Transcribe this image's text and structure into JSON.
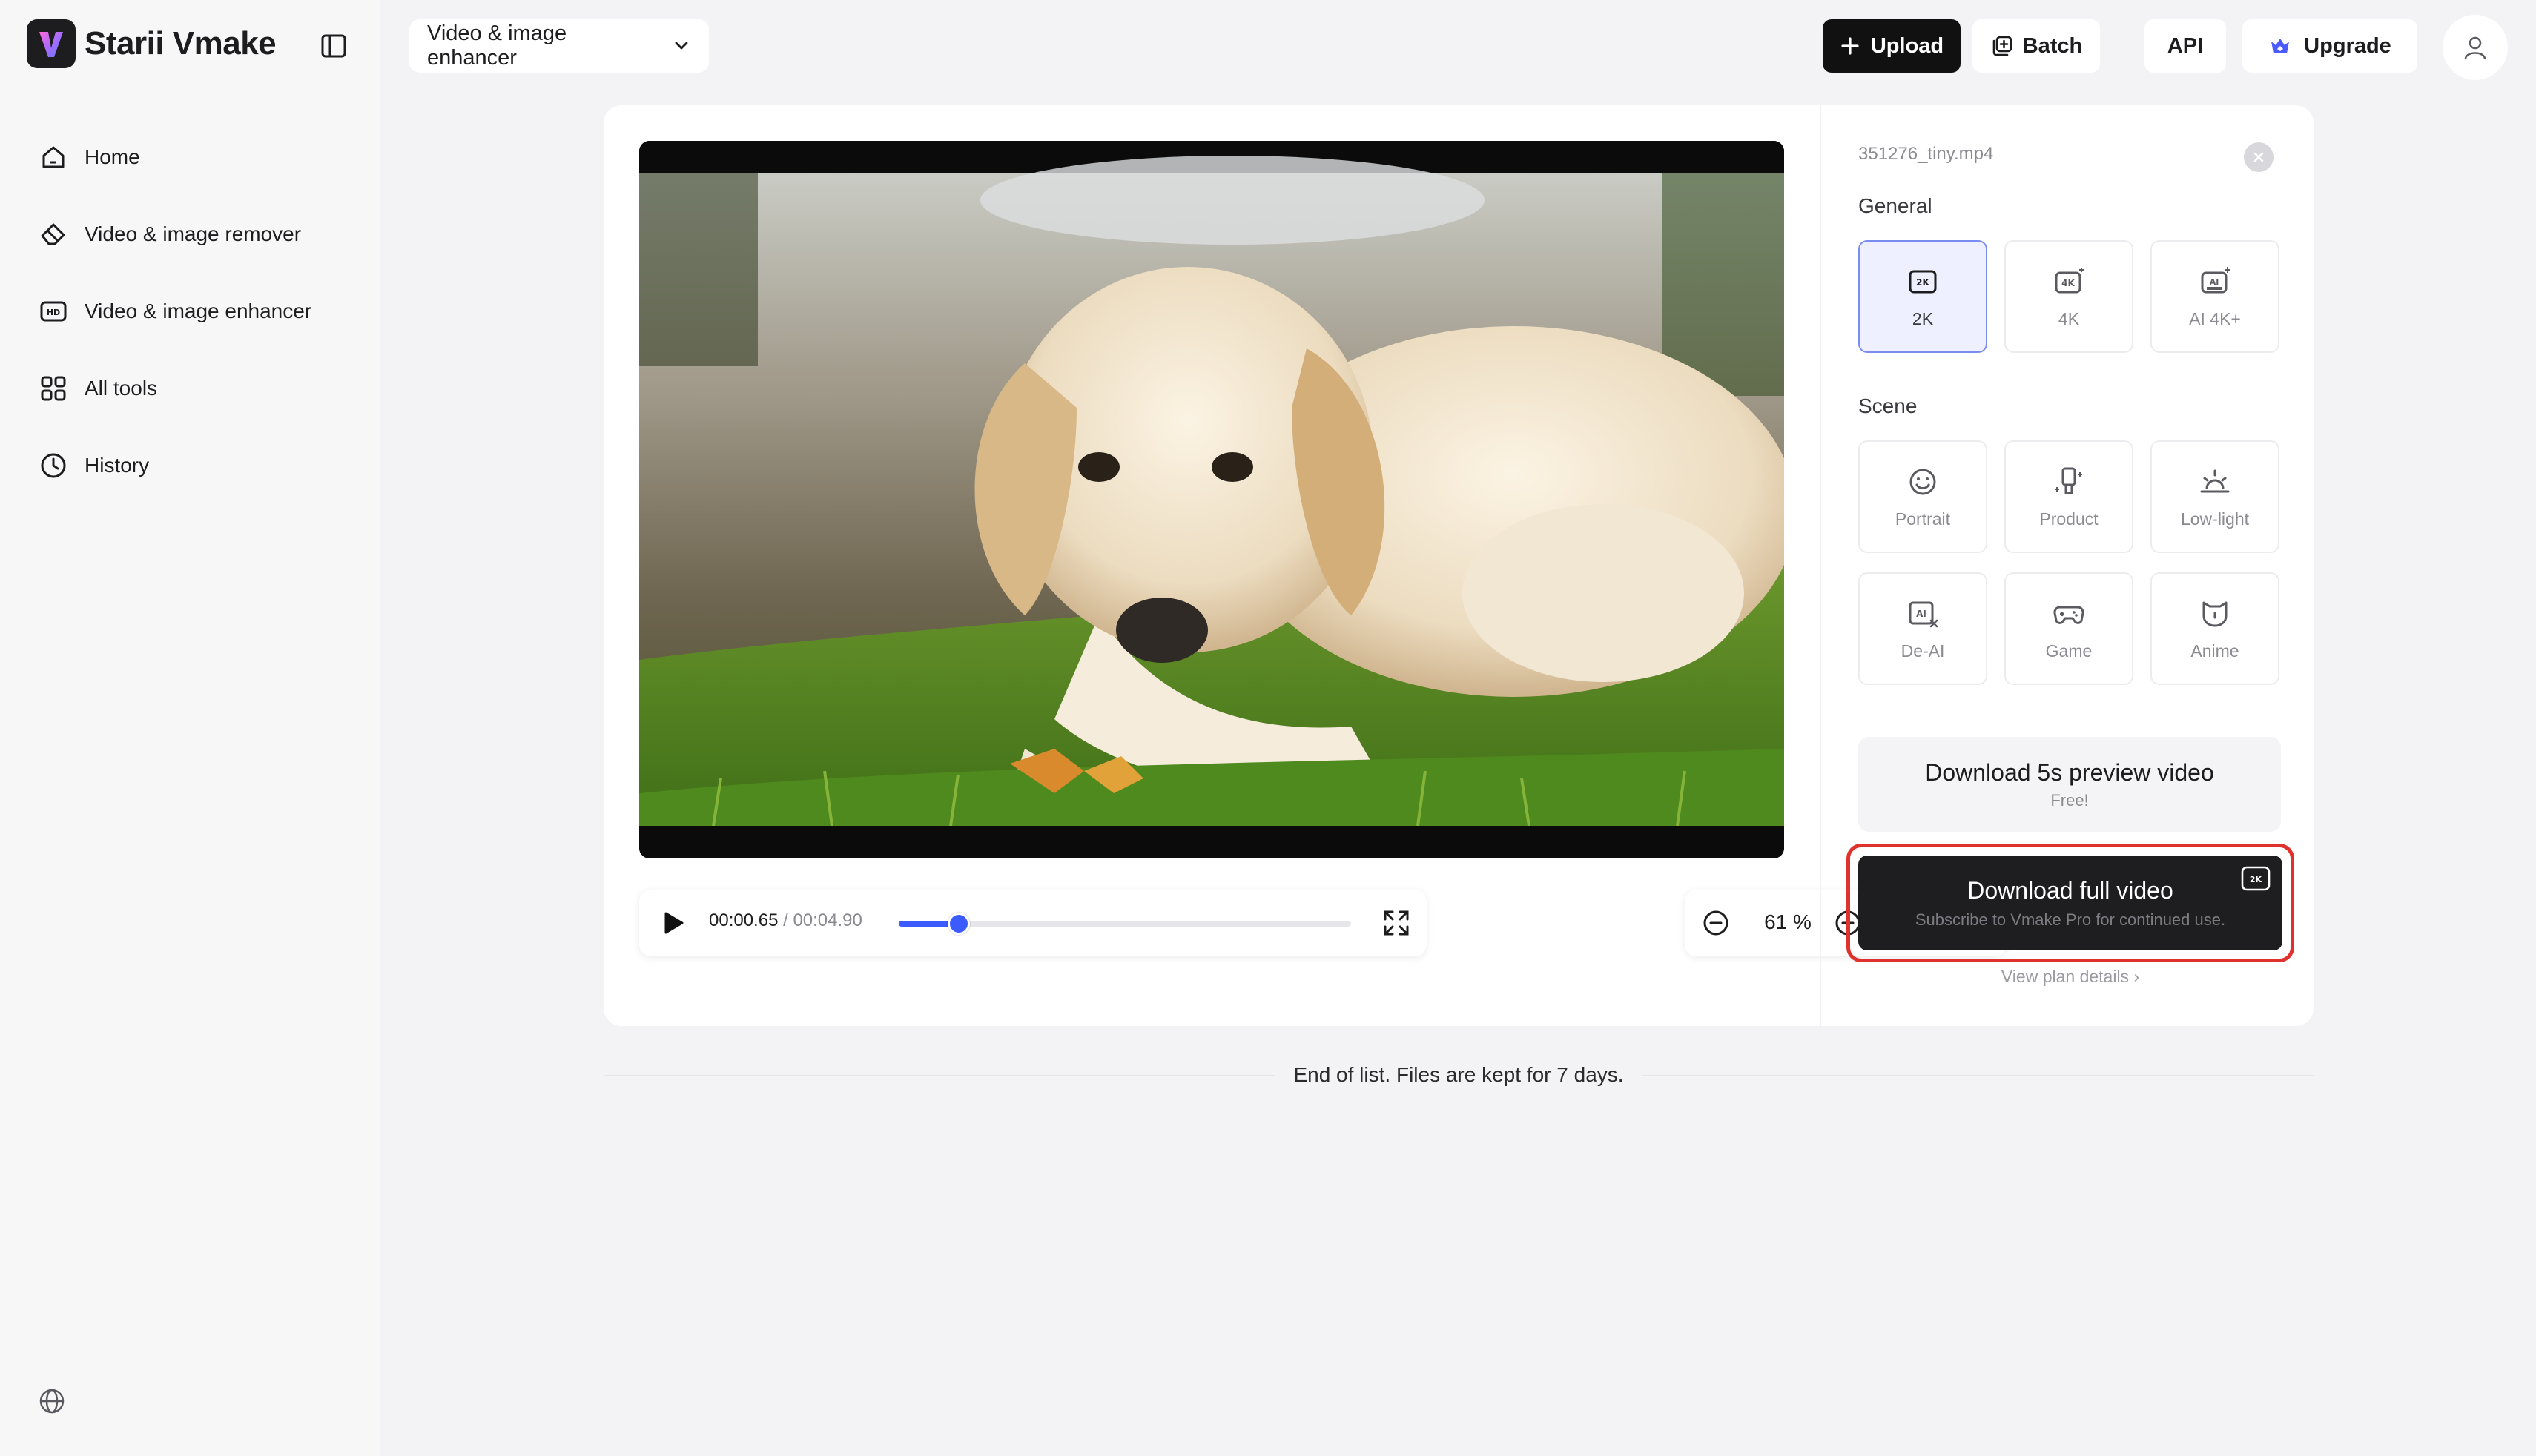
{
  "app": {
    "name": "Starii Vmake"
  },
  "sidebar": {
    "items": [
      {
        "label": "Home",
        "icon": "home-icon"
      },
      {
        "label": "Video & image remover",
        "icon": "eraser-icon"
      },
      {
        "label": "Video & image enhancer",
        "icon": "hd-icon"
      },
      {
        "label": "All tools",
        "icon": "grid-icon"
      },
      {
        "label": "History",
        "icon": "clock-icon"
      }
    ]
  },
  "header": {
    "tool_select": "Video & image enhancer",
    "upload_label": "Upload",
    "batch_label": "Batch",
    "api_label": "API",
    "upgrade_label": "Upgrade"
  },
  "player": {
    "current_time": "00:00.65",
    "separator": " / ",
    "duration": "00:04.90",
    "progress": 0.133,
    "zoom": "61 %"
  },
  "panel": {
    "filename": "351276_tiny.mp4",
    "general_title": "General",
    "general_options": [
      {
        "label": "2K",
        "selected": true
      },
      {
        "label": "4K",
        "selected": false
      },
      {
        "label": "AI 4K+",
        "selected": false
      }
    ],
    "scene_title": "Scene",
    "scene_options": [
      {
        "label": "Portrait"
      },
      {
        "label": "Product"
      },
      {
        "label": "Low-light"
      },
      {
        "label": "De-AI"
      },
      {
        "label": "Game"
      },
      {
        "label": "Anime"
      }
    ],
    "preview_button": {
      "label": "Download 5s preview video",
      "sub": "Free!"
    },
    "full_button": {
      "label": "Download full video",
      "sub": "Subscribe to Vmake Pro for continued use."
    },
    "plan_link": "View plan details ›"
  },
  "footer": {
    "end_text": "End of list. Files are kept for 7 days."
  },
  "colors": {
    "accent": "#3b5bff",
    "highlight": "#e0322d",
    "dark_button": "#1e1e20"
  }
}
